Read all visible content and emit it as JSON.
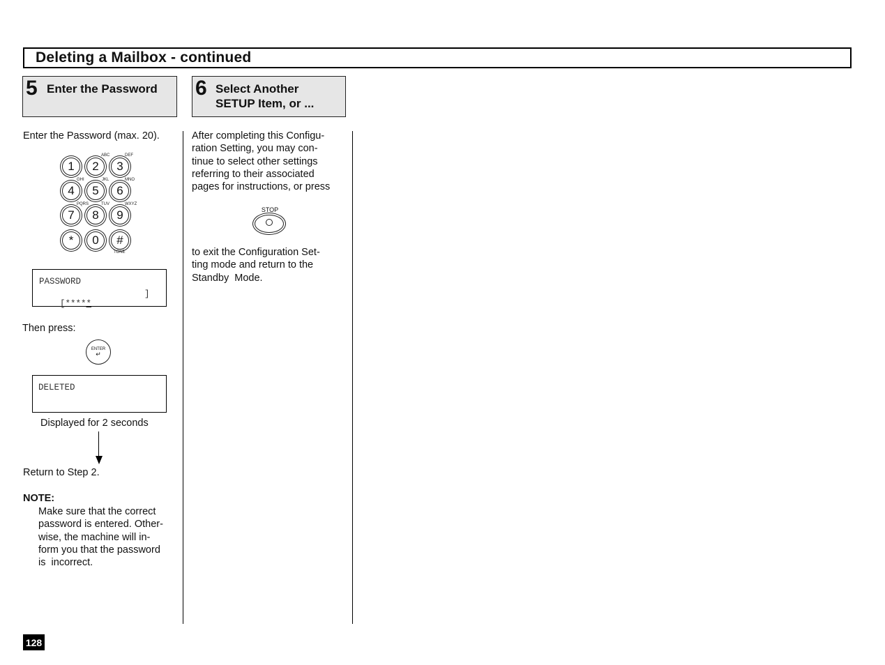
{
  "header": {
    "title": "Deleting a Mailbox - continued"
  },
  "steps": [
    {
      "number": "5",
      "title": "Enter the Password"
    },
    {
      "number": "6",
      "title_line1": "Select Another",
      "title_line2": "SETUP Item, or ..."
    }
  ],
  "step5": {
    "instruction": "Enter the Password (max. 20).",
    "keypad": {
      "keys": [
        "1",
        "2",
        "3",
        "4",
        "5",
        "6",
        "7",
        "8",
        "9",
        "*",
        "0",
        "#"
      ],
      "sublabels": {
        "2": "ABC",
        "3": "DEF",
        "4": "GHI",
        "5": "JKL",
        "6": "MNO",
        "7": "PQRS",
        "8": "TUV",
        "9": "WXYZ",
        "#": "TONE"
      }
    },
    "lcd1": {
      "line1": "PASSWORD",
      "line2_prefix": "[****",
      "line2_cursor": "*",
      "line2_suffix": "]"
    },
    "then_press": "Then press:",
    "enter_key_label": "ENTER",
    "lcd2": {
      "line1": "DELETED"
    },
    "displayed_for": "Displayed for 2 seconds",
    "return_to": "Return to Step 2.",
    "note_label": "NOTE:",
    "note_lines": [
      "Make sure that the correct",
      "password is entered. Other-",
      "wise, the machine will in-",
      "form you that the password",
      "is  incorrect."
    ]
  },
  "step6": {
    "para1_lines": [
      "After completing this Configu-",
      "ration Setting, you may con-",
      "tinue to select other settings",
      "referring to their associated",
      "pages for instructions, or press"
    ],
    "stop_key_label": "STOP",
    "para2_lines": [
      "to exit the Configuration Set-",
      "ting mode and return to the",
      "Standby  Mode."
    ]
  },
  "footer": {
    "page_number": "128"
  }
}
